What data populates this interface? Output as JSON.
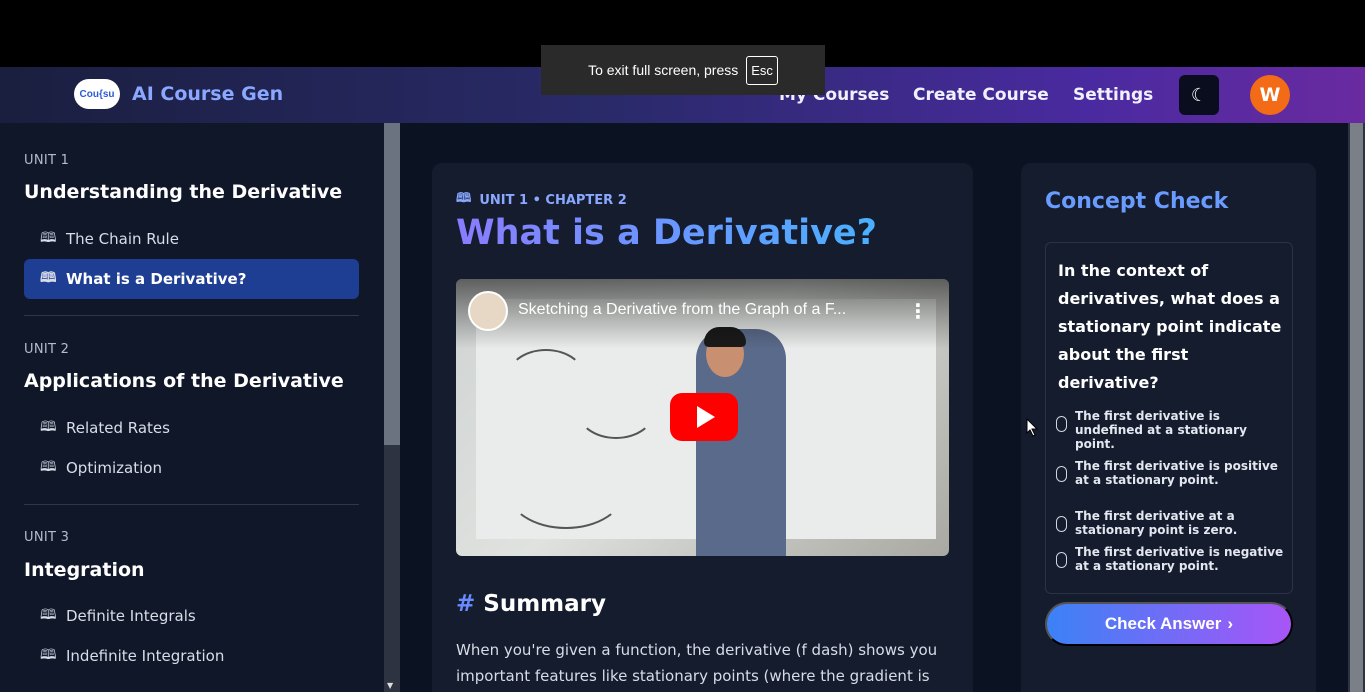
{
  "fullscreen_toast": {
    "text": "To exit full screen, press",
    "key": "Esc"
  },
  "navbar": {
    "logo_text": "Cou{su",
    "brand": "AI Course Gen",
    "links": [
      "My Courses",
      "Create Course",
      "Settings"
    ],
    "theme_icon": "moon-icon",
    "avatar_initial": "W",
    "colors": {
      "avatar": "#f36b16",
      "brand": "#8aa8ff"
    }
  },
  "sidebar": {
    "units": [
      {
        "label": "UNIT 1",
        "title": "Understanding the Derivative",
        "chapters": [
          "The Chain Rule",
          "What is a Derivative?"
        ]
      },
      {
        "label": "UNIT 2",
        "title": "Applications of the Derivative",
        "chapters": [
          "Related Rates",
          "Optimization"
        ]
      },
      {
        "label": "UNIT 3",
        "title": "Integration",
        "chapters": [
          "Definite Integrals",
          "Indefinite Integration"
        ]
      }
    ],
    "active_chapter": "What is a Derivative?"
  },
  "content": {
    "breadcrumb": "UNIT 1 • CHAPTER 2",
    "title": "What is a Derivative?",
    "video": {
      "title": "Sketching a Derivative from the Graph of a F...",
      "menu_icon": "more-vert-icon",
      "play_icon": "youtube-play-icon"
    },
    "summary_heading": "Summary",
    "summary_text": "When you're given a function, the derivative (f dash) shows you important features like stationary points (where the gradient is"
  },
  "quiz": {
    "title": "Concept Check",
    "question": "In the context of derivatives, what does a stationary point indicate about the first derivative?",
    "options": [
      "The first derivative is undefined at a stationary point.",
      "The first derivative is positive at a stationary point.",
      "The first derivative at a stationary point is zero.",
      "The first derivative is negative at a stationary point."
    ],
    "button": "Check Answer",
    "button_icon": "chevron-right-icon"
  }
}
